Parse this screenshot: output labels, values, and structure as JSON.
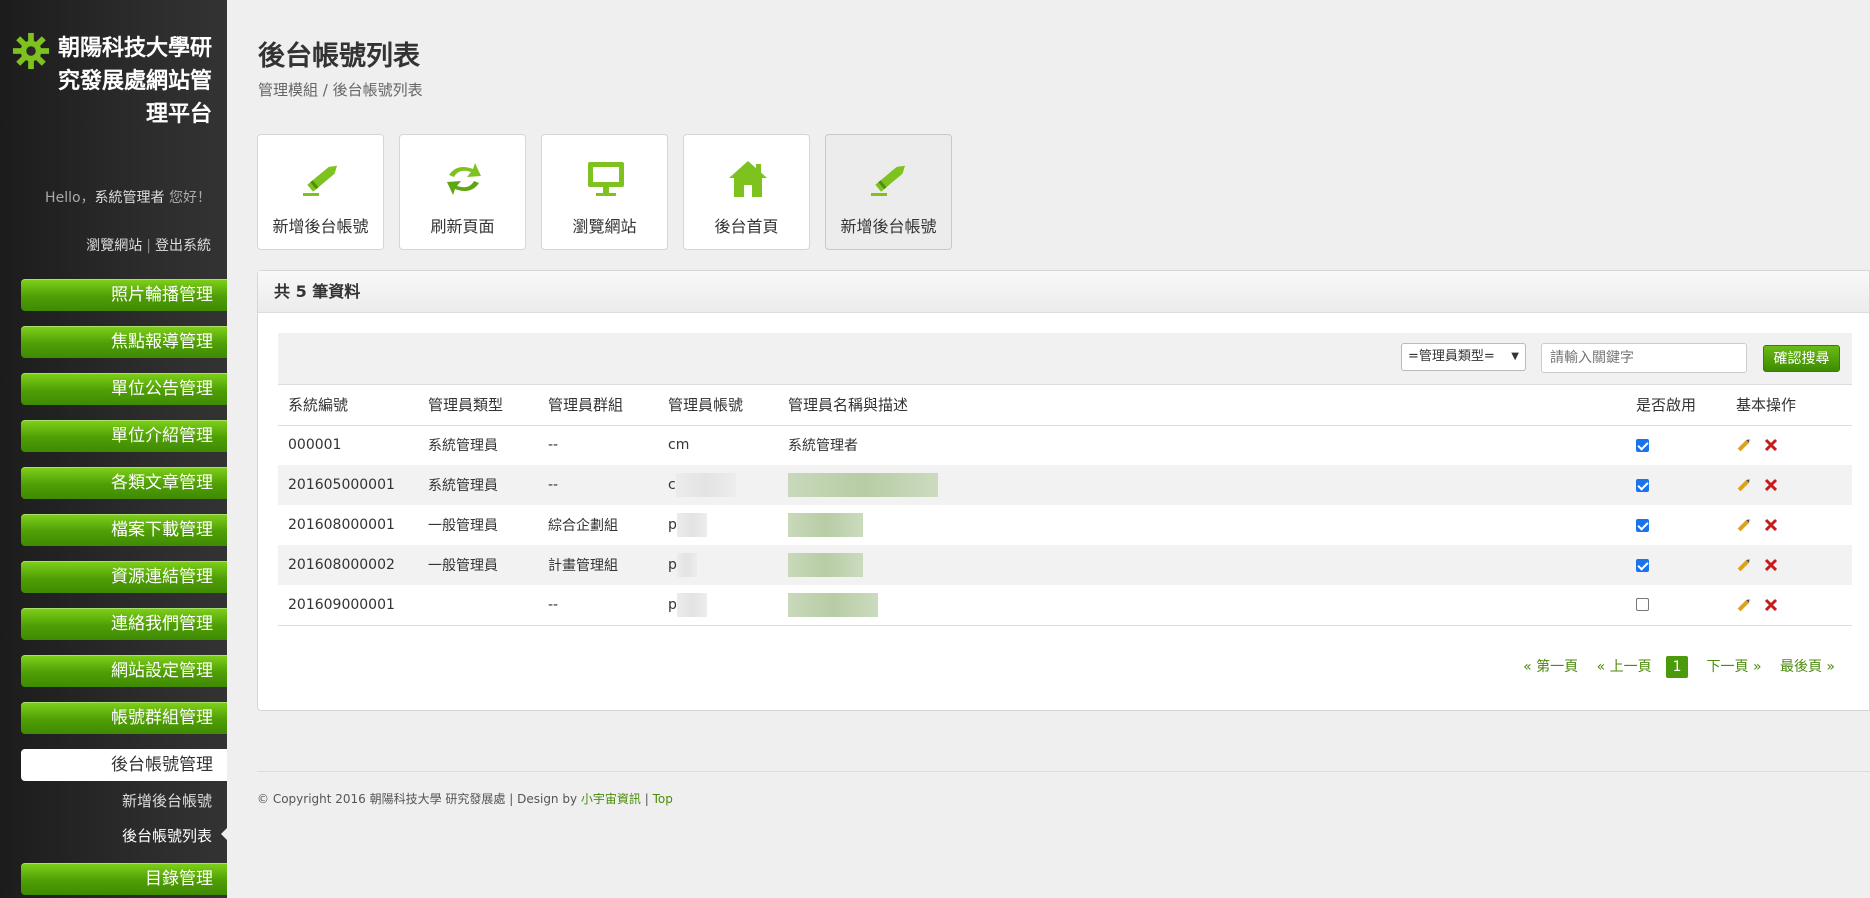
{
  "sidebar": {
    "brand_title": "朝陽科技大學研究發展處網站管理平台",
    "greeting_prefix": "Hello，",
    "user_name": "系統管理者",
    "greeting_suffix": "您好！",
    "link_browse": "瀏覽網站",
    "link_logout": "登出系統",
    "menu": [
      {
        "label": "照片輪播管理"
      },
      {
        "label": "焦點報導管理"
      },
      {
        "label": "單位公告管理"
      },
      {
        "label": "單位介紹管理"
      },
      {
        "label": "各類文章管理"
      },
      {
        "label": "檔案下載管理"
      },
      {
        "label": "資源連結管理"
      },
      {
        "label": "連絡我們管理"
      },
      {
        "label": "網站設定管理"
      },
      {
        "label": "帳號群組管理"
      },
      {
        "label": "後台帳號管理"
      },
      {
        "label": "目錄管理"
      }
    ],
    "submenu": [
      {
        "label": "新增後台帳號"
      },
      {
        "label": "後台帳號列表"
      }
    ]
  },
  "page": {
    "title": "後台帳號列表",
    "breadcrumb": "管理模組 / 後台帳號列表"
  },
  "tiles": [
    {
      "label": "新增後台帳號",
      "icon": "pencil-icon"
    },
    {
      "label": "刷新頁面",
      "icon": "refresh-icon"
    },
    {
      "label": "瀏覽網站",
      "icon": "monitor-icon"
    },
    {
      "label": "後台首頁",
      "icon": "home-icon"
    },
    {
      "label": "新增後台帳號",
      "icon": "pencil-icon"
    }
  ],
  "panel": {
    "record_count_text": "共 5 筆資料",
    "filter_select_value": "=管理員類型=",
    "keyword_placeholder": "請輸入關鍵字",
    "search_button": "確認搜尋"
  },
  "table": {
    "headers": [
      "系統編號",
      "管理員類型",
      "管理員群組",
      "管理員帳號",
      "管理員名稱與描述",
      "是否啟用",
      "基本操作"
    ],
    "rows": [
      {
        "id": "000001",
        "type": "系統管理員",
        "group": "--",
        "account": "cm",
        "name": "系統管理者",
        "enabled": true
      },
      {
        "id": "201605000001",
        "type": "系統管理員",
        "group": "--",
        "account": "c",
        "name": "",
        "enabled": true
      },
      {
        "id": "201608000001",
        "type": "一般管理員",
        "group": "綜合企劃組",
        "account": "p",
        "name": "",
        "enabled": true
      },
      {
        "id": "201608000002",
        "type": "一般管理員",
        "group": "計畫管理組",
        "account": "p",
        "name": "",
        "enabled": true
      },
      {
        "id": "201609000001",
        "type": "",
        "group": "--",
        "account": "p",
        "name": "",
        "enabled": false
      }
    ]
  },
  "pager": {
    "first": "« 第一頁",
    "prev": "« 上一頁",
    "current": "1",
    "next": "下一頁 »",
    "last": "最後頁 »"
  },
  "footer": {
    "text": "© Copyright 2016 朝陽科技大學 研究發展處 | Design by",
    "designer": "小宇宙資訊",
    "sep": "|",
    "top": "Top"
  },
  "colors": {
    "accent_green": "#4a9a0a",
    "sidebar_bg": "#2b2b2b",
    "page_bg": "#efefef"
  }
}
